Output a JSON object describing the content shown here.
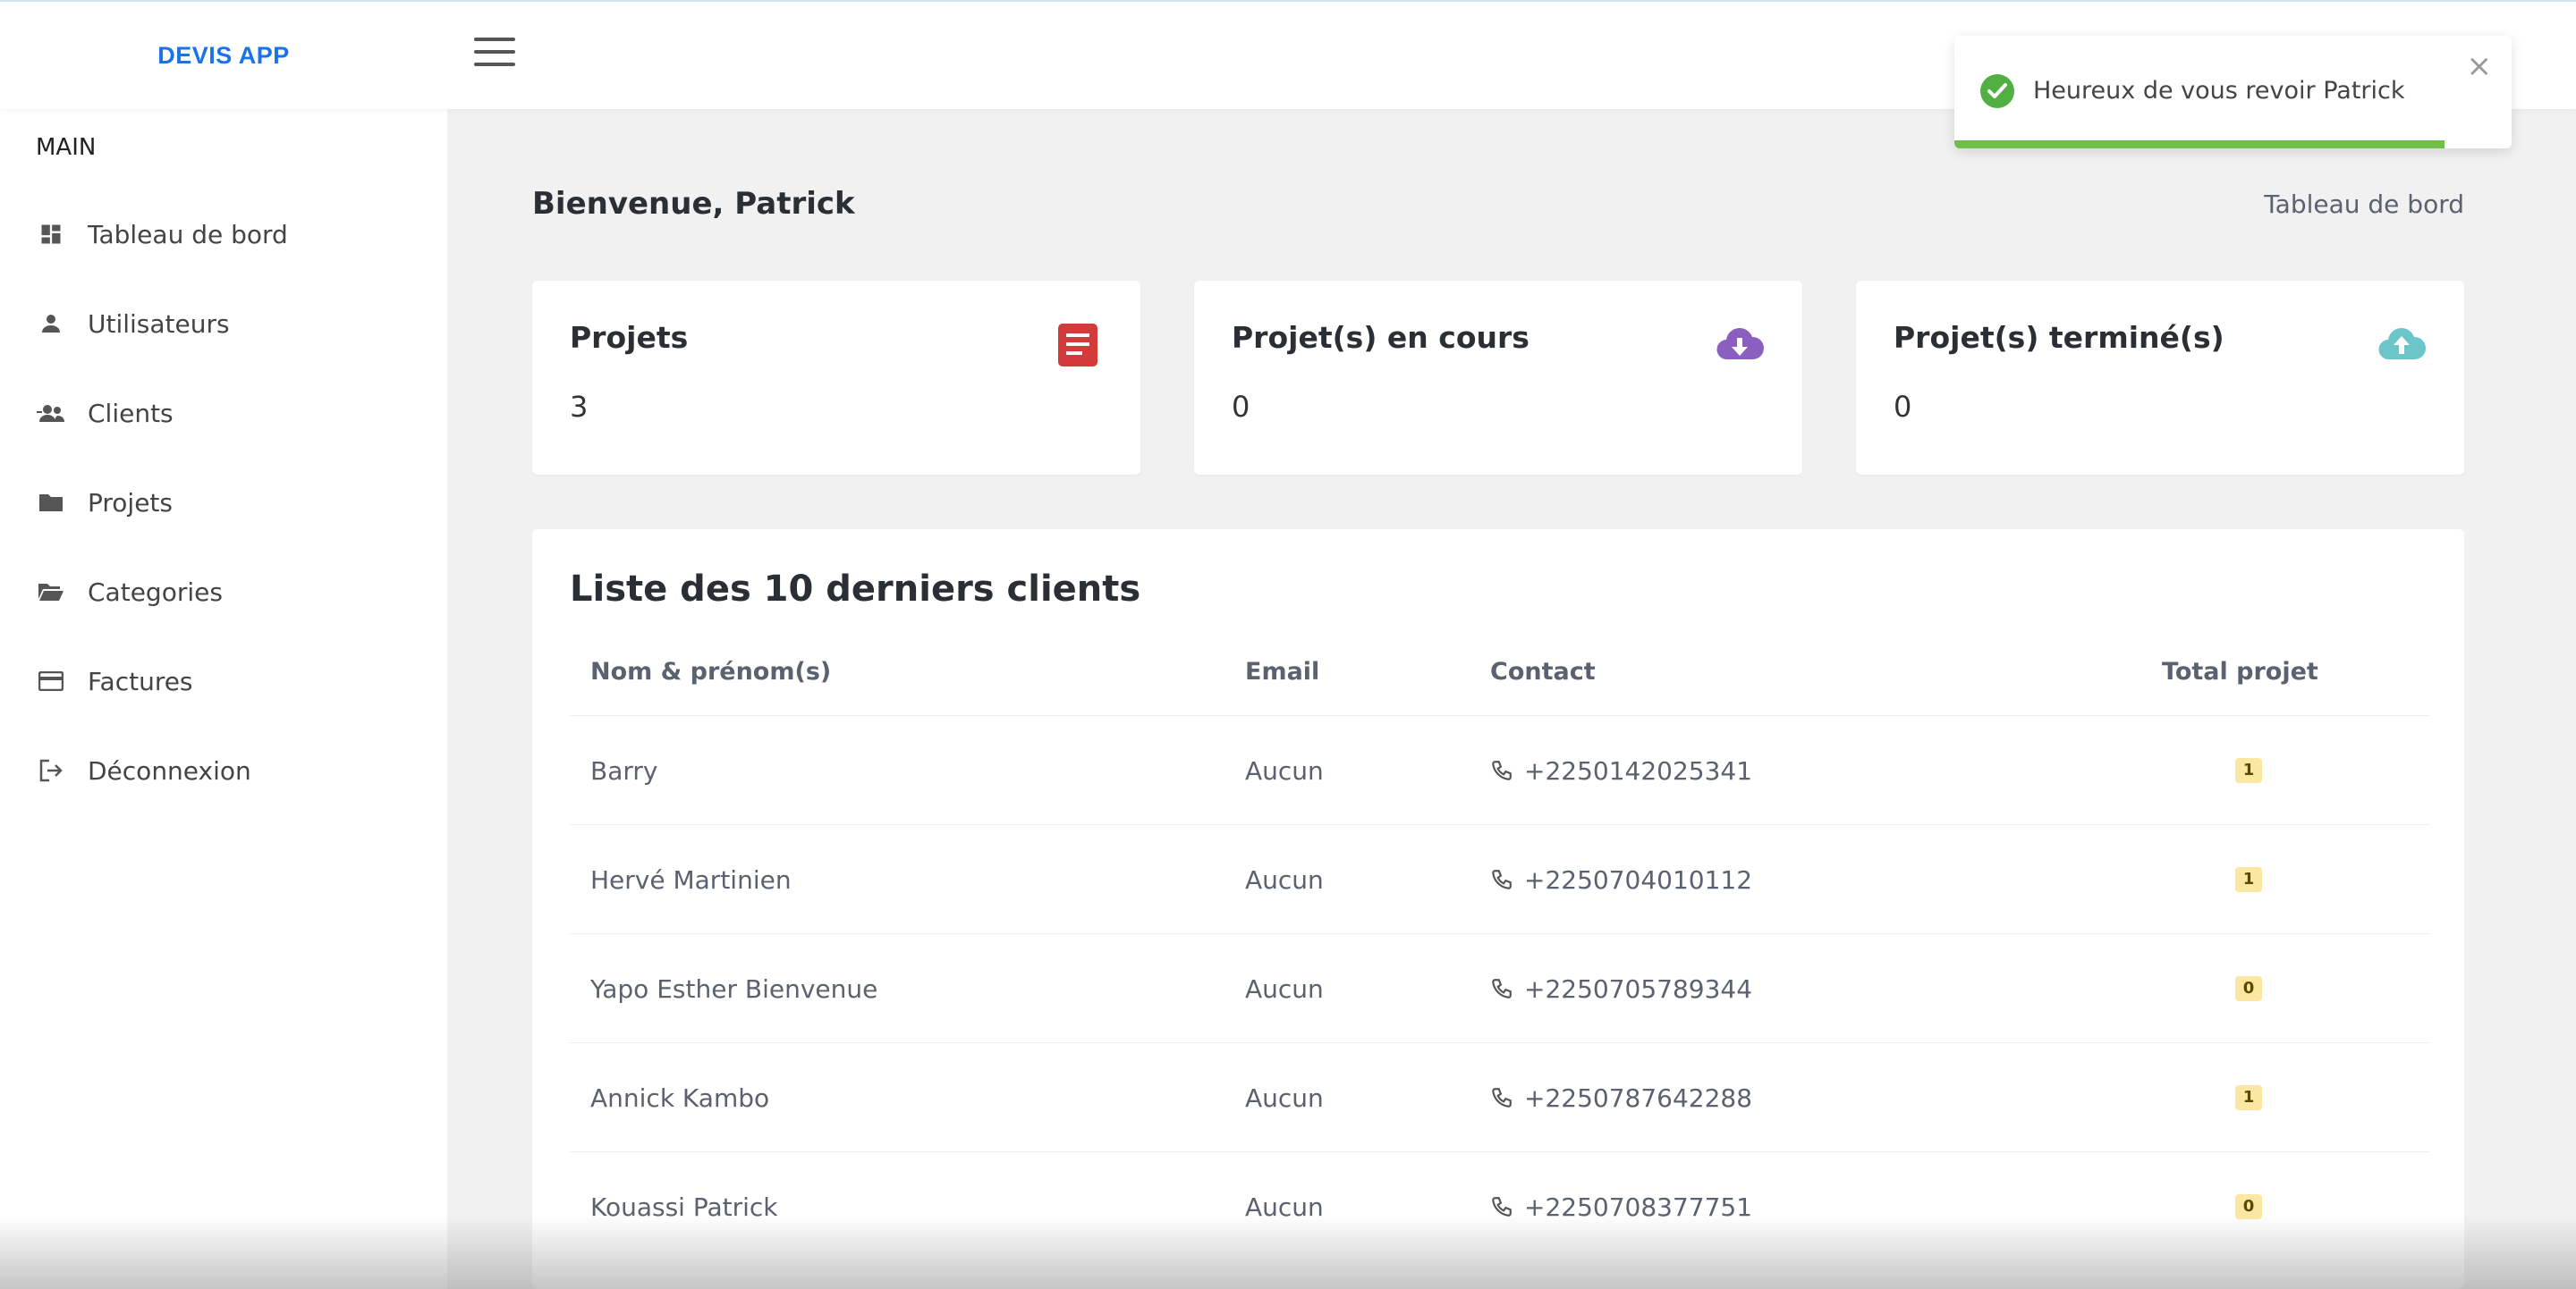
{
  "app": {
    "brand": "DEVIS APP"
  },
  "sidebar": {
    "section_label": "MAIN",
    "items": [
      {
        "label": "Tableau de bord",
        "icon": "dashboard-icon"
      },
      {
        "label": "Utilisateurs",
        "icon": "user-icon"
      },
      {
        "label": "Clients",
        "icon": "user-group-icon"
      },
      {
        "label": "Projets",
        "icon": "folder-icon"
      },
      {
        "label": "Categories",
        "icon": "folder-open-icon"
      },
      {
        "label": "Factures",
        "icon": "credit-card-icon"
      },
      {
        "label": "Déconnexion",
        "icon": "logout-icon"
      }
    ]
  },
  "header": {
    "welcome": "Bienvenue, Patrick",
    "breadcrumb": "Tableau de bord"
  },
  "stats": [
    {
      "title": "Projets",
      "value": "3",
      "icon": "document-icon",
      "color": "#d33a3a"
    },
    {
      "title": "Projet(s) en cours",
      "value": "0",
      "icon": "cloud-download-icon",
      "color": "#8b5fbf"
    },
    {
      "title": "Projet(s) terminé(s)",
      "value": "0",
      "icon": "cloud-upload-icon",
      "color": "#6cc5c9"
    }
  ],
  "clients_table": {
    "title": "Liste des 10 derniers clients",
    "headers": [
      "Nom & prénom(s)",
      "Email",
      "Contact",
      "Total projet"
    ],
    "rows": [
      {
        "name": "Barry",
        "email": "Aucun",
        "contact": "+2250142025341",
        "total": "1"
      },
      {
        "name": "Hervé Martinien",
        "email": "Aucun",
        "contact": "+2250704010112",
        "total": "1"
      },
      {
        "name": "Yapo Esther Bienvenue",
        "email": "Aucun",
        "contact": "+2250705789344",
        "total": "0"
      },
      {
        "name": "Annick Kambo",
        "email": "Aucun",
        "contact": "+2250787642288",
        "total": "1"
      },
      {
        "name": "Kouassi Patrick",
        "email": "Aucun",
        "contact": "+2250708377751",
        "total": "0"
      }
    ]
  },
  "toast": {
    "message": "Heureux de vous revoir Patrick",
    "close_glyph": "×",
    "progress": 0.88,
    "color": "#6fbf4a"
  }
}
